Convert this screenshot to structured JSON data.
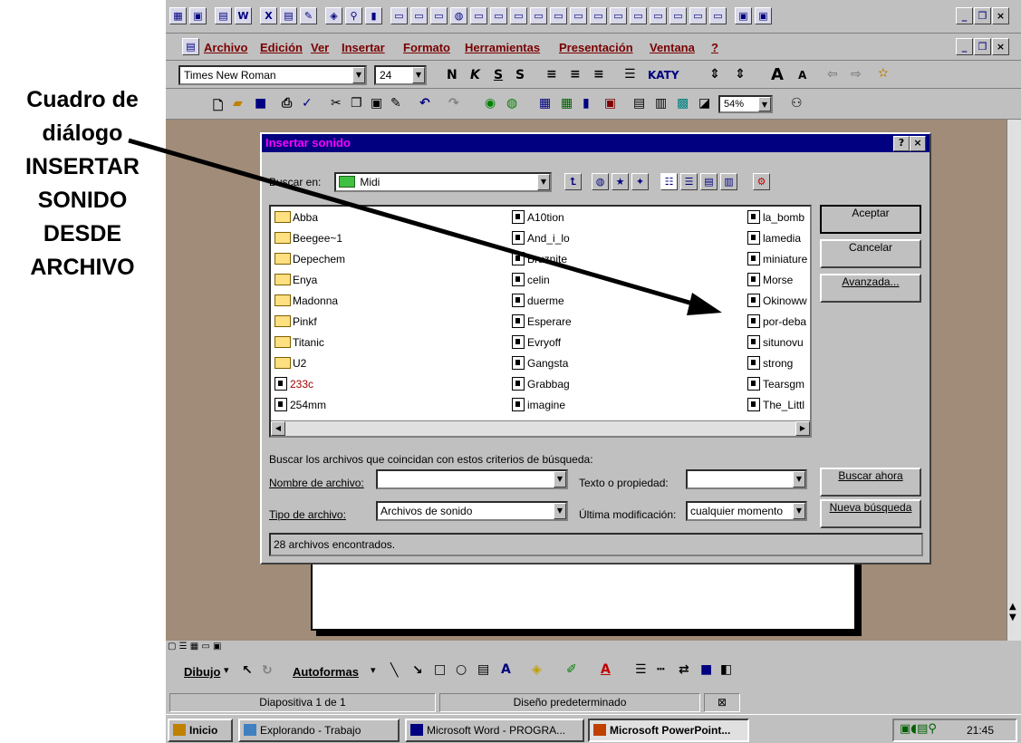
{
  "annotation": {
    "lines": [
      "Cuadro de",
      "diálogo",
      "INSERTAR",
      "SONIDO",
      "DESDE",
      "ARCHIVO"
    ]
  },
  "toolbar_top": {
    "icons": [
      "excel-icon",
      "save-icon",
      "doc-icon",
      "word-icon",
      "excel2-icon",
      "word2-icon",
      "draw-icon",
      "paint-icon",
      "find-icon",
      "chart-icon",
      "window-icon",
      "window-icon",
      "window-icon",
      "globe-icon",
      "window-icon",
      "window-icon",
      "window-icon",
      "window-icon",
      "window-icon",
      "window-icon",
      "window-icon",
      "window-icon",
      "window-icon",
      "window-icon",
      "window-icon",
      "window-icon",
      "window-icon",
      "app-icon",
      "app-icon"
    ]
  },
  "menu": {
    "items": [
      "Archivo",
      "Edición",
      "Ver",
      "Insertar",
      "Formato",
      "Herramientas",
      "Presentación",
      "Ventana",
      "?"
    ]
  },
  "format_toolbar": {
    "font": "Times New Roman",
    "size": "24",
    "bold": "N",
    "italic": "K",
    "underline": "S",
    "shadow": "S",
    "katy": "KATY"
  },
  "standard_toolbar": {
    "zoom": "54%"
  },
  "dialog": {
    "title": "Insertar sonido",
    "look_in_label": "Buscar en:",
    "look_in_value": "Midi",
    "files": [
      [
        "Abba",
        "Beegee~1",
        "Depechem",
        "Enya",
        "Madonna",
        "Pinkf",
        "Titanic",
        "U2",
        "233c",
        "254mm"
      ],
      [
        "A10tion",
        "And_i_lo",
        "Bruznite",
        "celin",
        "duerme",
        "Esperare",
        "Evryoff",
        "Gangsta",
        "Grabbag",
        "imagine"
      ],
      [
        "la_bomb",
        "lamedia",
        "miniature",
        "Morse",
        "Okinoww",
        "por-deba",
        "situnovu",
        "strong",
        "Tearsgm",
        "The_Littl"
      ]
    ],
    "buttons": {
      "accept": "Aceptar",
      "cancel": "Cancelar",
      "advanced": "Avanzada...",
      "search_now": "Buscar ahora",
      "new_search": "Nueva búsqueda"
    },
    "criteria_label": "Buscar los archivos que coincidan con estos criterios de búsqueda:",
    "filename_label": "Nombre de archivo:",
    "filename_value": "",
    "text_label": "Texto o propiedad:",
    "text_value": "",
    "filetype_label": "Tipo de archivo:",
    "filetype_value": "Archivos de sonido",
    "modified_label": "Última modificación:",
    "modified_value": "cualquier momento",
    "status": "28 archivos encontrados."
  },
  "drawing_toolbar": {
    "draw": "Dibujo",
    "autoshapes": "Autoformas"
  },
  "statusbar": {
    "slide": "Diapositiva 1 de 1",
    "design": "Diseño predeterminado"
  },
  "taskbar": {
    "start": "Inicio",
    "tasks": [
      "Explorando - Trabajo",
      "Microsoft Word - PROGRA...",
      "Microsoft PowerPoint..."
    ],
    "clock": "21:45"
  }
}
